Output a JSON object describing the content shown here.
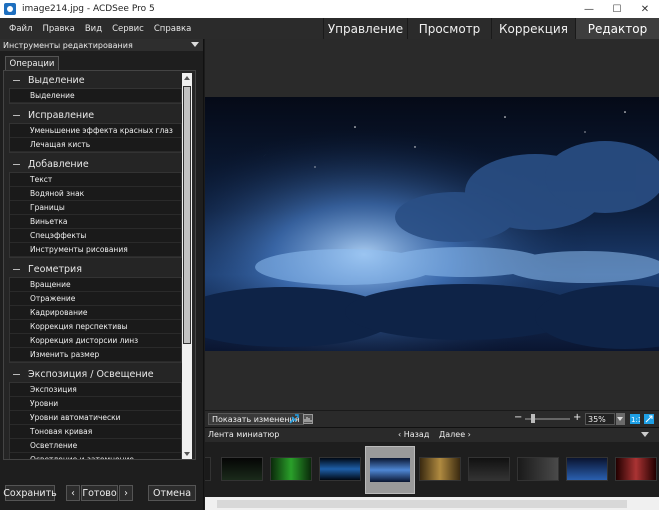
{
  "window": {
    "title": "image214.jpg - ACDSee Pro 5"
  },
  "menu": [
    "Файл",
    "Правка",
    "Вид",
    "Сервис",
    "Справка"
  ],
  "modes": [
    {
      "label": "Управление",
      "active": false
    },
    {
      "label": "Просмотр",
      "active": false
    },
    {
      "label": "Коррекция",
      "active": false
    },
    {
      "label": "Редактор",
      "active": true
    }
  ],
  "panel": {
    "title": "Инструменты редактирования",
    "tab": "Операции",
    "groups": [
      {
        "title": "Выделение",
        "items": [
          "Выделение"
        ]
      },
      {
        "title": "Исправление",
        "items": [
          "Уменьшение эффекта красных глаз",
          "Лечащая кисть"
        ]
      },
      {
        "title": "Добавление",
        "items": [
          "Текст",
          "Водяной знак",
          "Границы",
          "Виньетка",
          "Спецэффекты",
          "Инструменты рисования"
        ]
      },
      {
        "title": "Геометрия",
        "items": [
          "Вращение",
          "Отражение",
          "Кадрирование",
          "Коррекция перспективы",
          "Коррекция дисторсии линз",
          "Изменить размер"
        ]
      },
      {
        "title": "Экспозиция / Освещение",
        "items": [
          "Экспозиция",
          "Уровни",
          "Уровни автоматически",
          "Тоновая кривая",
          "Осветление",
          "Осветление и затемнение"
        ]
      }
    ]
  },
  "footer": {
    "save": "Сохранить",
    "done": "Готово",
    "cancel": "Отмена",
    "prev": "‹",
    "next": "›"
  },
  "viewer": {
    "show_changes": "Показать изменения",
    "zoom": "35%",
    "zoom_minus": "−",
    "zoom_plus": "+"
  },
  "filmstrip": {
    "title": "Лента миниатюр",
    "back": "‹ Назад",
    "forward": "Далее ›"
  },
  "colors": {
    "accent_blue": "#1ea0e6",
    "active_tab": "#3e3e3e"
  }
}
